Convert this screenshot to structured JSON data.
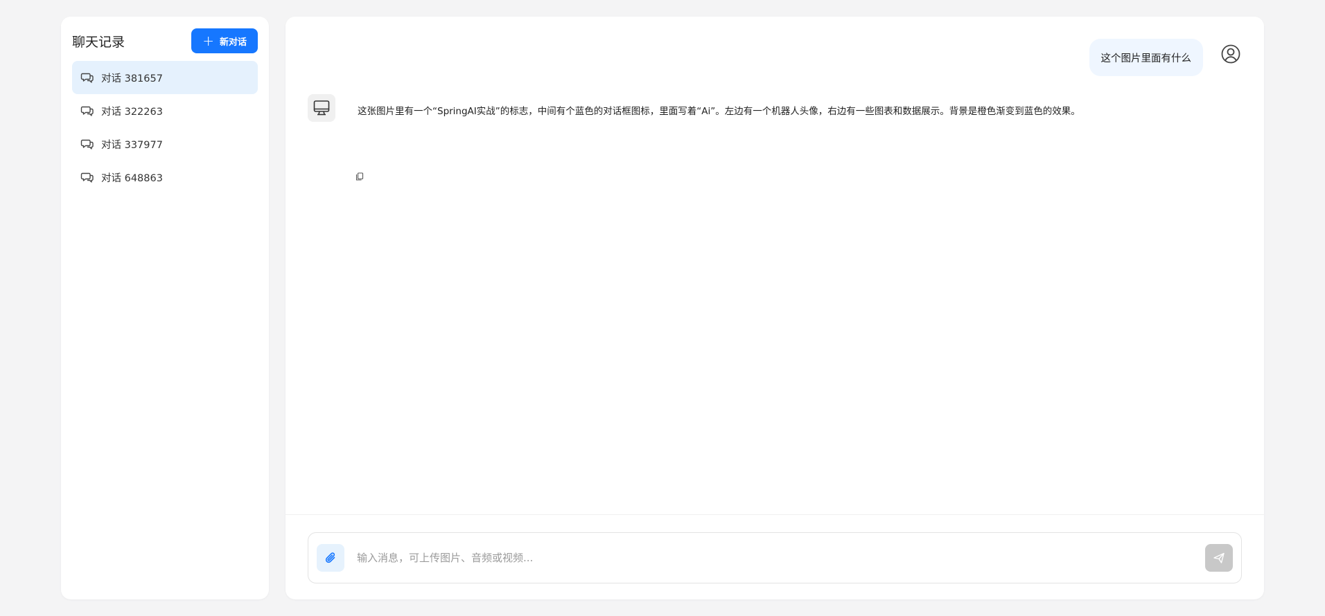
{
  "sidebar": {
    "title": "聊天记录",
    "new_chat_label": "新对话",
    "items": [
      {
        "label": "对话 381657",
        "active": true
      },
      {
        "label": "对话 322263",
        "active": false
      },
      {
        "label": "对话 337977",
        "active": false
      },
      {
        "label": "对话 648863",
        "active": false
      }
    ]
  },
  "chat": {
    "user_message": "这个图片里面有什么",
    "bot_message": "这张图片里有一个“SpringAI实战”的标志，中间有个蓝色的对话框图标，里面写着“Ai”。左边有一个机器人头像，右边有一些图表和数据展示。背景是橙色渐变到蓝色的效果。"
  },
  "input": {
    "placeholder": "输入消息，可上传图片、音频或视频..."
  },
  "colors": {
    "accent": "#1677ff",
    "active_item_bg": "#e5f1fd",
    "user_bubble_bg": "#eff6ff",
    "send_disabled": "#c8c8c8"
  },
  "icons": {
    "new_chat": "plus-icon",
    "conversation": "chat-bubbles-icon",
    "user_avatar": "user-circle-icon",
    "bot_avatar": "monitor-icon",
    "copy": "copy-icon",
    "attach": "paperclip-icon",
    "send": "send-icon"
  }
}
